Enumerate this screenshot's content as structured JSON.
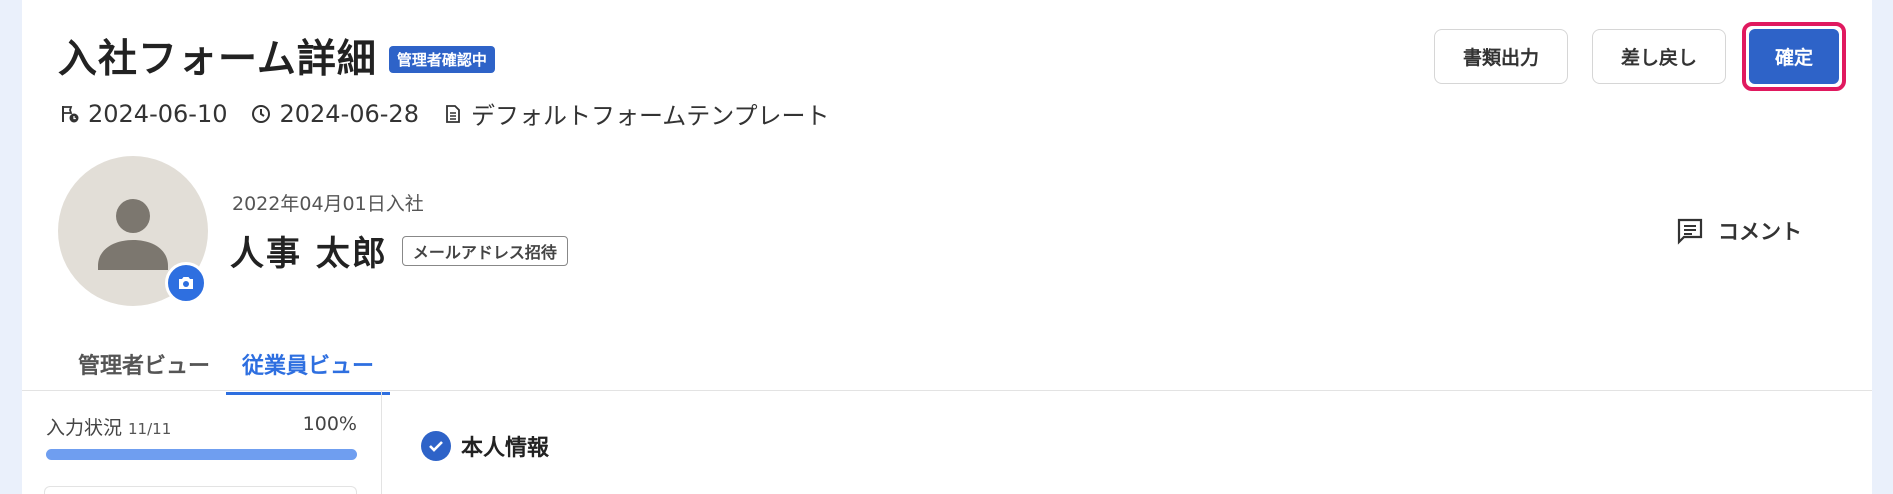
{
  "header": {
    "title": "入社フォーム詳細",
    "status_badge": "管理者確認中",
    "submitted_date": "2024-06-10",
    "deadline_date": "2024-06-28",
    "template_name": "デフォルトフォームテンプレート"
  },
  "actions": {
    "export_label": "書類出力",
    "return_label": "差し戻し",
    "confirm_label": "確定"
  },
  "employee": {
    "join_date": "2022年04月01日入社",
    "name": "人事 太郎",
    "invite_badge": "メールアドレス招待"
  },
  "comment": {
    "label": "コメント"
  },
  "tabs": [
    {
      "label": "管理者ビュー",
      "active": false
    },
    {
      "label": "従業員ビュー",
      "active": true
    }
  ],
  "progress": {
    "label": "入力状況",
    "count": "11/11",
    "percent_text": "100%",
    "fraction": 1.0
  },
  "section": {
    "title": "本人情報"
  },
  "colors": {
    "accent": "#2e63c8",
    "highlight": "#e0195f",
    "progress": "#6f9ef0"
  },
  "icons": {
    "submitted": "flag-clock-icon",
    "deadline": "clock-icon",
    "template": "document-icon",
    "camera": "camera-icon",
    "comment": "comment-icon",
    "check": "check-circle-icon"
  }
}
